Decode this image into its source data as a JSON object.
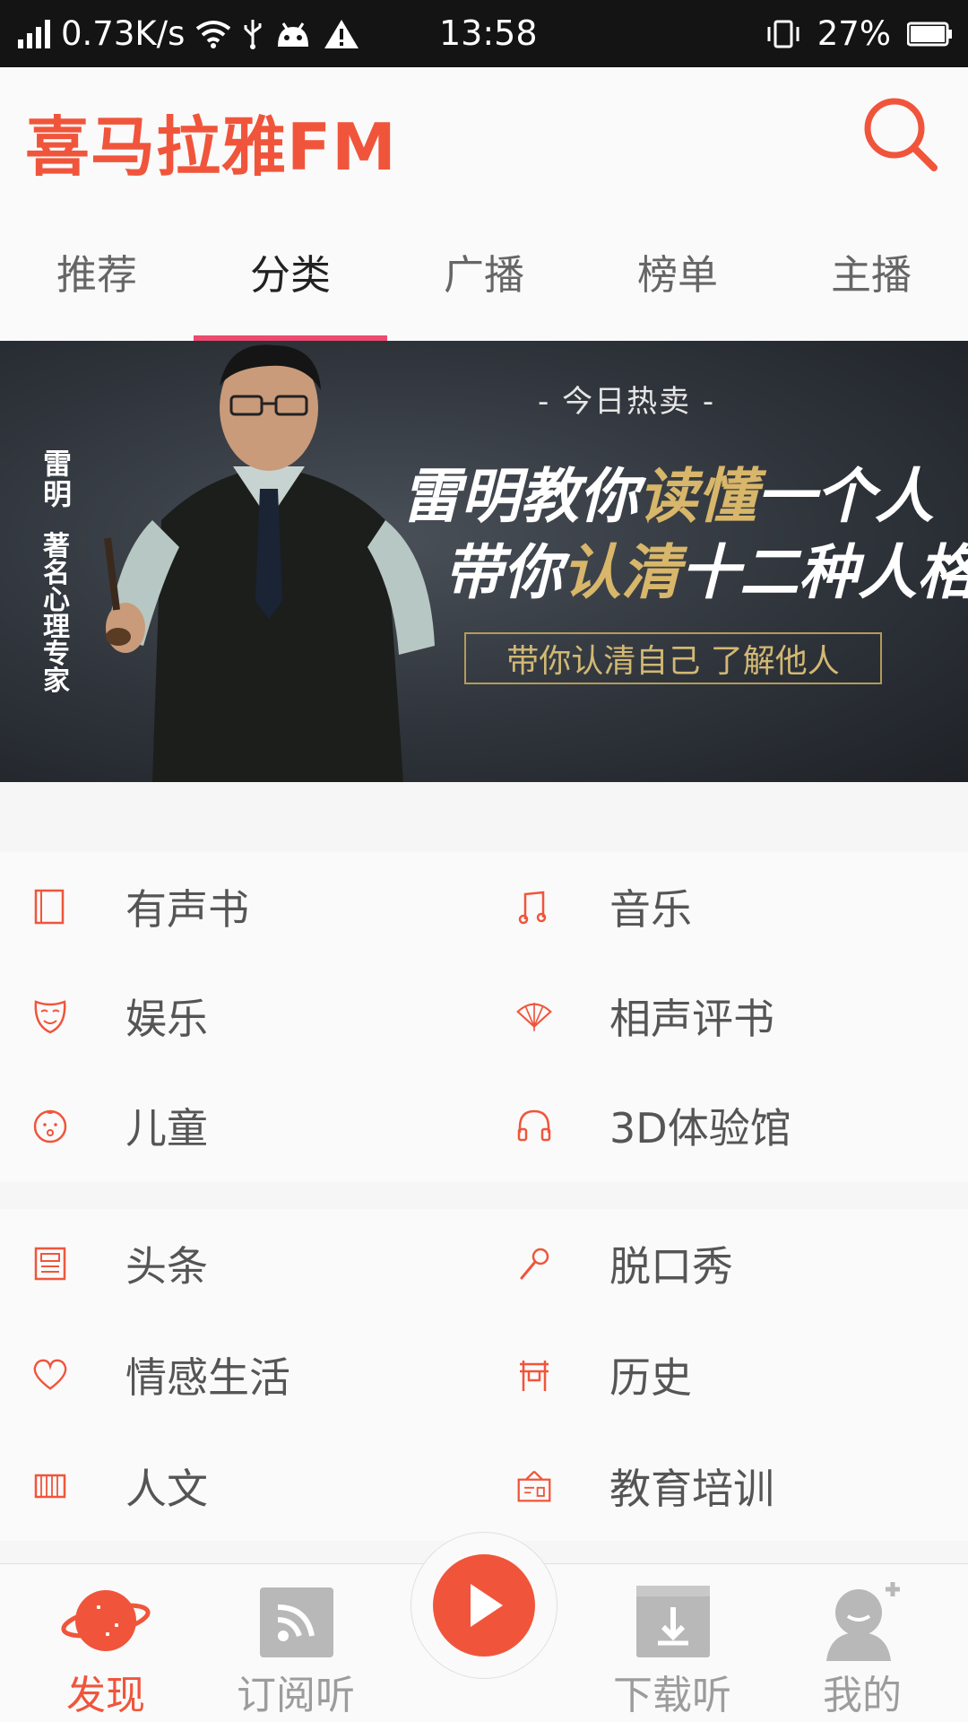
{
  "status_bar": {
    "network_speed": "0.73K/s",
    "time": "13:58",
    "battery": "27%",
    "icons": [
      "signal-icon",
      "wifi-icon",
      "usb-icon",
      "android-icon",
      "warning-icon",
      "vibrate-icon",
      "battery-icon"
    ]
  },
  "header": {
    "logo": "喜马拉雅FM",
    "search_icon": "search-icon",
    "accent": "#f0553b"
  },
  "tabs": [
    {
      "label": "推荐",
      "active": false
    },
    {
      "label": "分类",
      "active": true
    },
    {
      "label": "广播",
      "active": false
    },
    {
      "label": "榜单",
      "active": false
    },
    {
      "label": "主播",
      "active": false
    }
  ],
  "banner": {
    "vertical_name": "雷明",
    "vertical_subtitle": "著名心理专家",
    "kicker": "- 今日热卖 -",
    "line1_pre": "雷明教你",
    "line1_hl": "读懂",
    "line1_post": "一个人",
    "line2_pre": "带你",
    "line2_hl": "认清",
    "line2_post": "十二种人格",
    "boxed": "带你认清自己  了解他人"
  },
  "categories_1": [
    {
      "label": "有声书",
      "icon": "book-icon"
    },
    {
      "label": "音乐",
      "icon": "music-icon"
    },
    {
      "label": "娱乐",
      "icon": "mask-icon"
    },
    {
      "label": "相声评书",
      "icon": "fan-icon"
    },
    {
      "label": "儿童",
      "icon": "baby-face-icon"
    },
    {
      "label": "3D体验馆",
      "icon": "headphones-icon"
    }
  ],
  "categories_2": [
    {
      "label": "头条",
      "icon": "newspaper-icon"
    },
    {
      "label": "脱口秀",
      "icon": "microphone-icon"
    },
    {
      "label": "情感生活",
      "icon": "heart-icon"
    },
    {
      "label": "历史",
      "icon": "gate-icon"
    },
    {
      "label": "人文",
      "icon": "scroll-icon"
    },
    {
      "label": "教育培训",
      "icon": "blackboard-icon"
    }
  ],
  "bottom_nav": [
    {
      "label": "发现",
      "icon": "planet-icon",
      "active": true
    },
    {
      "label": "订阅听",
      "icon": "rss-icon",
      "active": false
    },
    {
      "label": "下载听",
      "icon": "download-box-icon",
      "active": false
    },
    {
      "label": "我的",
      "icon": "profile-icon",
      "active": false
    }
  ],
  "play_icon": "play-icon"
}
